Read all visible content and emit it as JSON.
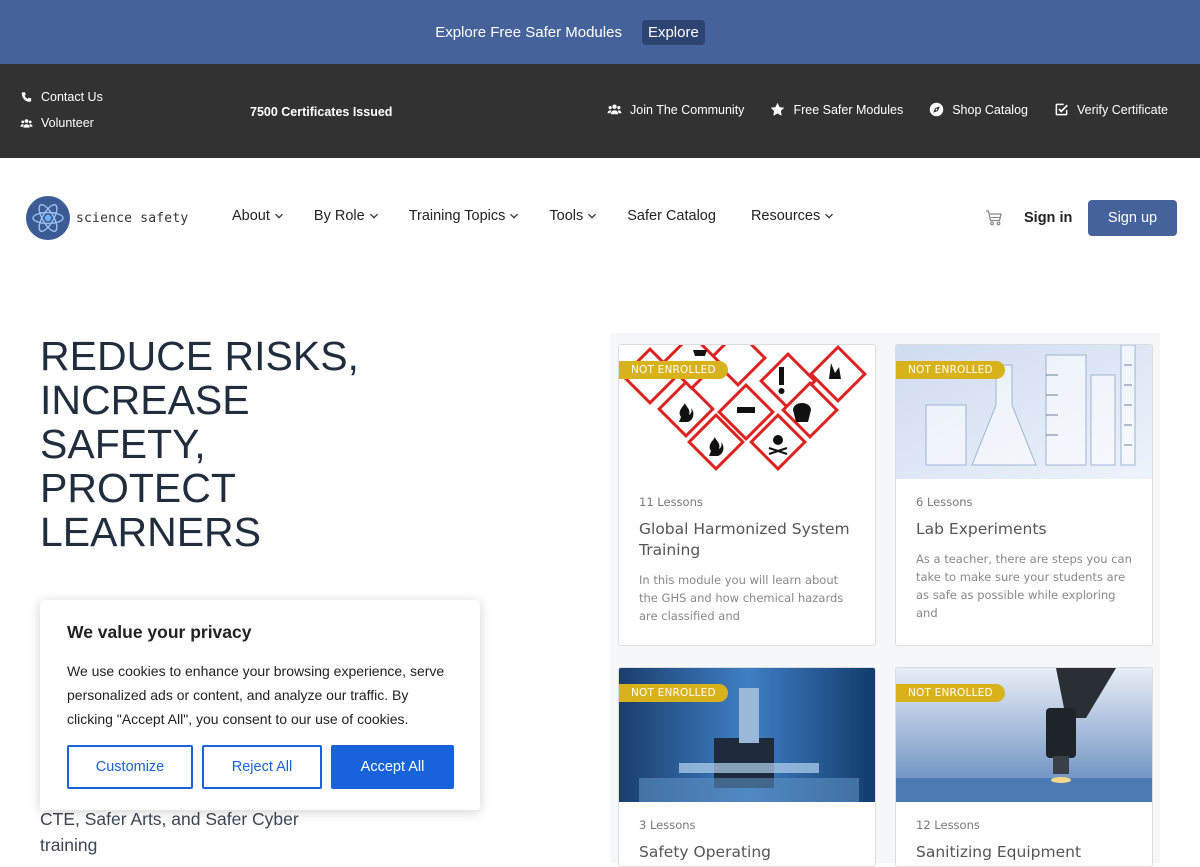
{
  "promo": {
    "text": "Explore Free Safer Modules",
    "button": "Explore"
  },
  "utility": {
    "contact": "Contact Us",
    "volunteer": "Volunteer",
    "certificates": "7500 Certificates Issued",
    "links": [
      {
        "label": "Join The Community",
        "icon": "users-icon"
      },
      {
        "label": "Free Safer Modules",
        "icon": "star-icon"
      },
      {
        "label": "Shop Catalog",
        "icon": "compass-icon"
      },
      {
        "label": "Verify Certificate",
        "icon": "check-square-icon"
      }
    ]
  },
  "nav": {
    "logo_text": "science safety",
    "menu": [
      {
        "label": "About",
        "dropdown": true
      },
      {
        "label": "By Role",
        "dropdown": true
      },
      {
        "label": "Training Topics",
        "dropdown": true
      },
      {
        "label": "Tools",
        "dropdown": true
      },
      {
        "label": "Safer Catalog",
        "dropdown": false
      },
      {
        "label": "Resources",
        "dropdown": true
      }
    ],
    "signin": "Sign in",
    "signup": "Sign up"
  },
  "hero": {
    "title": "REDUCE RISKS, INCREASE SAFETY, PROTECT LEARNERS",
    "subtitle": "CTE, Safer Arts, and Safer Cyber training"
  },
  "courses": [
    {
      "badge": "NOT ENROLLED",
      "lessons": "11 Lessons",
      "title": "Global Harmonized System Training",
      "desc": "In this module you will learn about the GHS and how chemical hazards are classified and"
    },
    {
      "badge": "NOT ENROLLED",
      "lessons": "6 Lessons",
      "title": "Lab Experiments",
      "desc": "As a teacher, there are steps you can take to make sure your students are as safe as possible while exploring and"
    },
    {
      "badge": "NOT ENROLLED",
      "lessons": "3 Lessons",
      "title": "Safety Operating Procedures",
      "desc": ""
    },
    {
      "badge": "NOT ENROLLED",
      "lessons": "12 Lessons",
      "title": "Sanitizing Equipment",
      "desc": ""
    }
  ],
  "cookie": {
    "title": "We value your privacy",
    "text": "We use cookies to enhance your browsing experience, serve personalized ads or content, and analyze our traffic. By clicking \"Accept All\", you consent to our use of cookies.",
    "customize": "Customize",
    "reject": "Reject All",
    "accept": "Accept All"
  },
  "colors": {
    "brand": "#46629b",
    "dark_bar": "#323232",
    "badge": "#d8b21a",
    "cookie_accent": "#1863dc"
  }
}
